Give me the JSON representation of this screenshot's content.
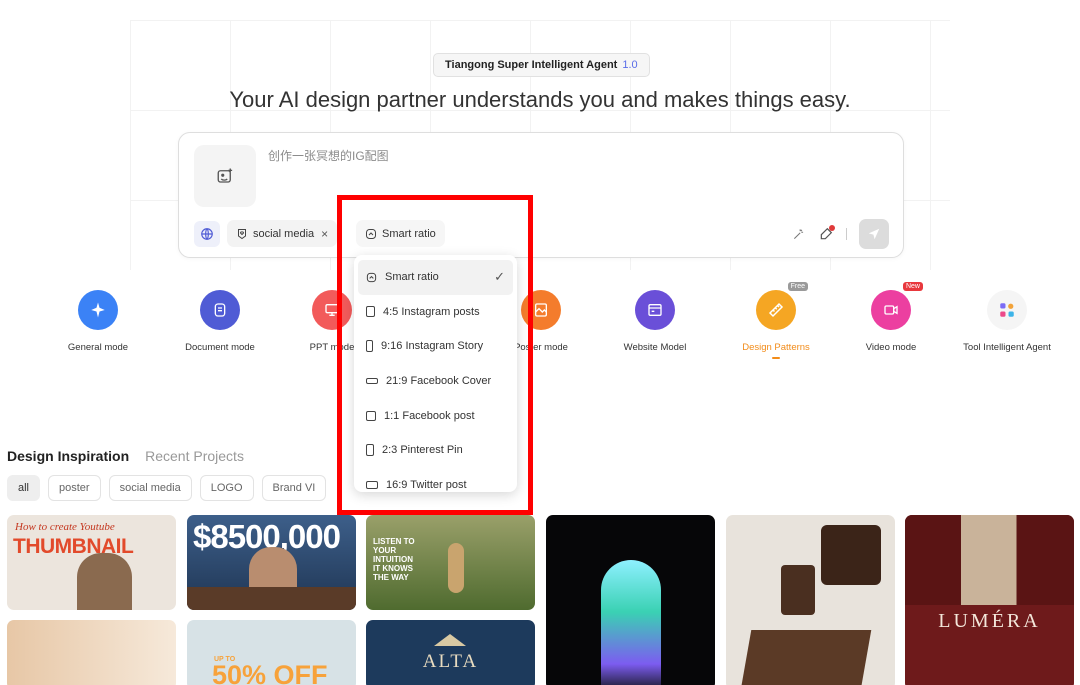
{
  "badge": {
    "title": "Tiangong Super Intelligent Agent",
    "version": "1.0"
  },
  "headline": "Your AI design partner understands you and makes things easy.",
  "composer": {
    "placeholder": "创作一张冥想的IG配图",
    "chip_social": "social media",
    "chip_ratio": "Smart ratio"
  },
  "ratio_menu": {
    "items": [
      {
        "label": "Smart ratio",
        "icon": "smart-ratio-icon",
        "selected": true
      },
      {
        "label": "4:5 Instagram posts",
        "icon": "portrait-ratio-icon"
      },
      {
        "label": "9:16 Instagram Story",
        "icon": "tall-ratio-icon"
      },
      {
        "label": "21:9 Facebook Cover",
        "icon": "wide-ratio-icon"
      },
      {
        "label": "1:1 Facebook post",
        "icon": "square-ratio-icon"
      },
      {
        "label": "2:3 Pinterest Pin",
        "icon": "portrait-ratio-icon"
      },
      {
        "label": "16:9 Twitter post",
        "icon": "landscape-ratio-icon"
      }
    ]
  },
  "modes": [
    {
      "label": "General mode",
      "color": "#3b82f6",
      "icon": "sparkle-icon"
    },
    {
      "label": "Document mode",
      "color": "#4f5bd5",
      "icon": "document-icon"
    },
    {
      "label": "PPT mode",
      "color": "#f25a5a",
      "icon": "presentation-icon"
    },
    {
      "label": "Poster mode",
      "color": "#f47c2c",
      "icon": "poster-icon"
    },
    {
      "label": "Website Model",
      "color": "#6a4fd8",
      "icon": "website-icon"
    },
    {
      "label": "Design Patterns",
      "color": "#f5a623",
      "icon": "ruler-icon",
      "tag": "Free",
      "active": true
    },
    {
      "label": "Video mode",
      "color": "#ec3fa0",
      "icon": "video-icon",
      "tag": "New"
    },
    {
      "label": "Tool Intelligent Agent",
      "color": "#f3f3f3",
      "icon": "tools-icon"
    }
  ],
  "tabs": {
    "inspiration": "Design Inspiration",
    "recent": "Recent Projects"
  },
  "filters": [
    "all",
    "poster",
    "social media",
    "LOGO",
    "Brand VI"
  ],
  "gallery": {
    "thumb1_line1": "How to create Youtube",
    "thumb1_line2": "THUMBNAIL",
    "thumb2_text": "$8500,000",
    "thumb3_text": "LISTEN TO YOUR INTUITION IT KNOWS THE WAY",
    "thumb6_text": "LUMÉRA",
    "thumb8_text": "50% OFF",
    "thumb8_small": "UP TO",
    "thumb9_text": "ALTA"
  }
}
